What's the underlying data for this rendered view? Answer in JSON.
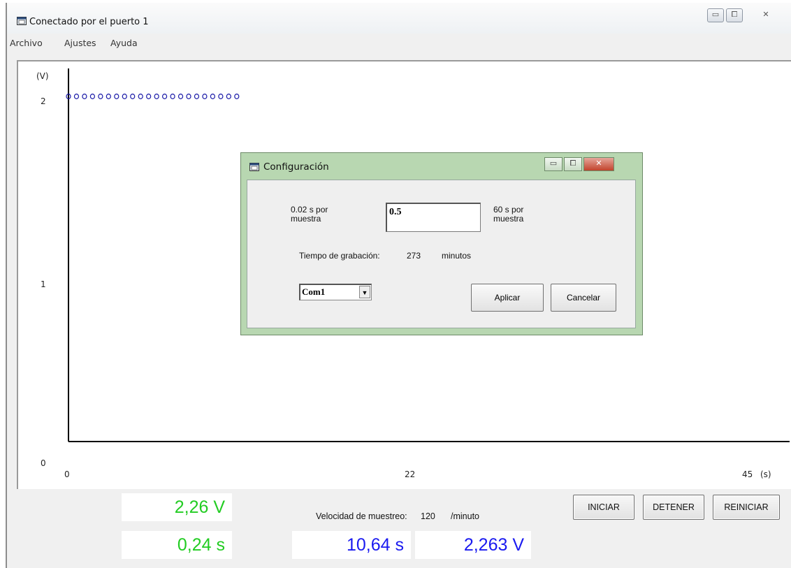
{
  "window": {
    "title": "Conectado por el puerto 1",
    "controls": {
      "minimize": "▭",
      "maximize": "⧠",
      "close": "✕"
    }
  },
  "menu": [
    "Archivo",
    "Ajustes",
    "Ayuda"
  ],
  "chart_data": {
    "type": "scatter",
    "ylabel": "(V)",
    "xunit": "(s)",
    "xlim": [
      0,
      45
    ],
    "ylim": [
      0,
      2
    ],
    "x_ticks": [
      "0",
      "22",
      "45"
    ],
    "y_ticks": [
      "0",
      "1",
      "2"
    ],
    "series": [
      {
        "marker": "circle",
        "color": "#1a1aa8",
        "x_start": 0,
        "x_end": 10.64,
        "x_step": 0.5,
        "y": 2.0
      }
    ]
  },
  "readouts": {
    "voltage": "2,26 V",
    "time": "0,24 s",
    "cursor_time": "10,64 s",
    "cursor_voltage": "2,263 V"
  },
  "sampling": {
    "label": "Velocidad de muestreo:",
    "value": "120",
    "unit": "/minuto"
  },
  "buttons": {
    "start": "INICIAR",
    "stop": "DETENER",
    "reset": "REINICIAR"
  },
  "colors": {
    "green_readout": "#22cc22",
    "blue_readout": "#1a1af0",
    "series": "#1a1aa8"
  },
  "dialog": {
    "title": "Configuración",
    "min_label": "0.02 s por\nmuestra",
    "max_label": "60 s por\nmuestra",
    "interval_value": "0.5",
    "record_label": "Tiempo de grabación:",
    "record_value": "273",
    "record_unit": "minutos",
    "port": "Com1",
    "apply": "Aplicar",
    "cancel": "Cancelar"
  }
}
